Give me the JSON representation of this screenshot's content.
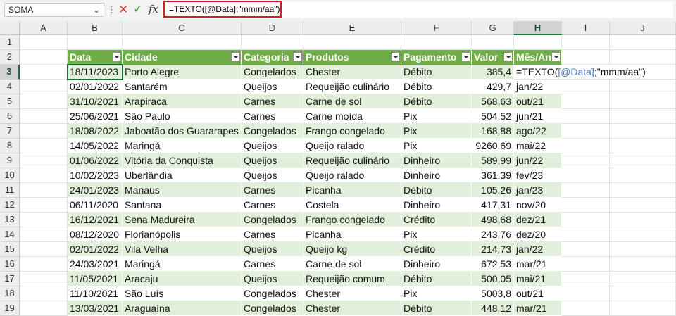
{
  "formula_bar": {
    "name_box": "SOMA",
    "formula": "=TEXTO([@Data];\"mmm/aa\")",
    "fx_label": "fx"
  },
  "columns": [
    "A",
    "B",
    "C",
    "D",
    "E",
    "F",
    "G",
    "H",
    "I",
    "J"
  ],
  "table_headers": [
    "Data",
    "Cidade",
    "Categoria",
    "Produtos",
    "Pagamento",
    "Valor",
    "Mês/An"
  ],
  "edit": {
    "prefix": "=TEXTO(",
    "ref": "[@Data]",
    "suffix": ";\"mmm/aa\")"
  },
  "rows": [
    {
      "n": "1"
    },
    {
      "n": "2"
    },
    {
      "n": "3",
      "data": "18/11/2023",
      "cidade": "Porto Alegre",
      "categoria": "Congelados",
      "produto": "Chester",
      "pagamento": "Débito",
      "valor": "385,4",
      "mes": ""
    },
    {
      "n": "4",
      "data": "02/01/2022",
      "cidade": "Santarém",
      "categoria": "Queijos",
      "produto": "Requeijão culinário",
      "pagamento": "Débito",
      "valor": "429,7",
      "mes": "jan/22"
    },
    {
      "n": "5",
      "data": "31/10/2021",
      "cidade": "Arapiraca",
      "categoria": "Carnes",
      "produto": "Carne de sol",
      "pagamento": "Débito",
      "valor": "568,63",
      "mes": "out/21"
    },
    {
      "n": "6",
      "data": "25/06/2021",
      "cidade": "São Paulo",
      "categoria": "Carnes",
      "produto": "Carne moída",
      "pagamento": "Pix",
      "valor": "504,52",
      "mes": "jun/21"
    },
    {
      "n": "7",
      "data": "18/08/2022",
      "cidade": "Jaboatão dos Guararapes",
      "categoria": "Congelados",
      "produto": "Frango congelado",
      "pagamento": "Pix",
      "valor": "168,88",
      "mes": "ago/22"
    },
    {
      "n": "8",
      "data": "14/05/2022",
      "cidade": "Maringá",
      "categoria": "Queijos",
      "produto": "Queijo ralado",
      "pagamento": "Pix",
      "valor": "9260,69",
      "mes": "mai/22"
    },
    {
      "n": "9",
      "data": "01/06/2022",
      "cidade": "Vitória da Conquista",
      "categoria": "Queijos",
      "produto": "Requeijão culinário",
      "pagamento": "Dinheiro",
      "valor": "589,99",
      "mes": "jun/22"
    },
    {
      "n": "10",
      "data": "10/02/2023",
      "cidade": "Uberlândia",
      "categoria": "Queijos",
      "produto": "Queijo ralado",
      "pagamento": "Dinheiro",
      "valor": "361,39",
      "mes": "fev/23"
    },
    {
      "n": "11",
      "data": "24/01/2023",
      "cidade": "Manaus",
      "categoria": "Carnes",
      "produto": "Picanha",
      "pagamento": "Débito",
      "valor": "105,26",
      "mes": "jan/23"
    },
    {
      "n": "12",
      "data": "06/11/2020",
      "cidade": "Santana",
      "categoria": "Carnes",
      "produto": "Costela",
      "pagamento": "Dinheiro",
      "valor": "417,31",
      "mes": "nov/20"
    },
    {
      "n": "13",
      "data": "16/12/2021",
      "cidade": "Sena Madureira",
      "categoria": "Congelados",
      "produto": "Frango congelado",
      "pagamento": "Crédito",
      "valor": "498,68",
      "mes": "dez/21"
    },
    {
      "n": "14",
      "data": "08/12/2020",
      "cidade": "Florianópolis",
      "categoria": "Carnes",
      "produto": "Picanha",
      "pagamento": "Pix",
      "valor": "243,76",
      "mes": "dez/20"
    },
    {
      "n": "15",
      "data": "02/01/2022",
      "cidade": "Vila Velha",
      "categoria": "Queijos",
      "produto": "Queijo kg",
      "pagamento": "Crédito",
      "valor": "214,73",
      "mes": "jan/22"
    },
    {
      "n": "16",
      "data": "24/03/2021",
      "cidade": "Maringá",
      "categoria": "Carnes",
      "produto": "Carne de sol",
      "pagamento": "Dinheiro",
      "valor": "672,53",
      "mes": "mar/21"
    },
    {
      "n": "17",
      "data": "11/05/2021",
      "cidade": "Aracaju",
      "categoria": "Queijos",
      "produto": "Requeijão comum",
      "pagamento": "Débito",
      "valor": "500,05",
      "mes": "mai/21"
    },
    {
      "n": "18",
      "data": "11/10/2021",
      "cidade": "São Luís",
      "categoria": "Congelados",
      "produto": "Chester",
      "pagamento": "Pix",
      "valor": "5003,8",
      "mes": "out/21"
    },
    {
      "n": "19",
      "data": "13/03/2021",
      "cidade": "Araguaína",
      "categoria": "Congelados",
      "produto": "Chester",
      "pagamento": "Débito",
      "valor": "448,12",
      "mes": "mar/21"
    }
  ]
}
